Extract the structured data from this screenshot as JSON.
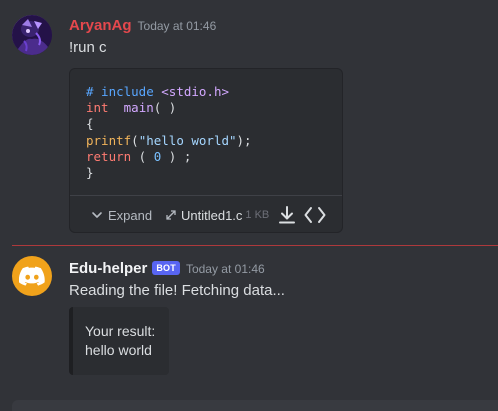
{
  "messages": [
    {
      "username": "AryanAg",
      "timestamp": "Today at 01:46",
      "text": "!run c",
      "attachment": {
        "code_lines": [
          [
            {
              "t": "# include ",
              "c": "kw-blue"
            },
            {
              "t": "<stdio.h>",
              "c": "kw-purple"
            }
          ],
          [
            {
              "t": "int ",
              "c": "kw-red"
            },
            {
              "t": " ",
              "c": ""
            },
            {
              "t": "main",
              "c": "kw-purple"
            },
            {
              "t": "( )",
              "c": ""
            }
          ],
          [
            {
              "t": "{",
              "c": ""
            }
          ],
          [
            {
              "t": "printf",
              "c": "kw-yellow"
            },
            {
              "t": "(",
              "c": ""
            },
            {
              "t": "\"hello world\"",
              "c": "str-blue"
            },
            {
              "t": ");",
              "c": ""
            }
          ],
          [
            {
              "t": "return",
              "c": "kw-red"
            },
            {
              "t": " ( ",
              "c": ""
            },
            {
              "t": "0",
              "c": "num-cyan"
            },
            {
              "t": " ) ;",
              "c": ""
            }
          ],
          [
            {
              "t": "}",
              "c": ""
            }
          ]
        ],
        "expand_label": "Expand",
        "filename": "Untitled1.c",
        "filesize": "1 KB"
      }
    },
    {
      "username": "Edu-helper",
      "bot_tag": "BOT",
      "timestamp": "Today at 01:46",
      "text": "Reading the file! Fetching data...",
      "embed": {
        "line1": "Your result:",
        "line2": "hello world"
      }
    }
  ],
  "colors": {
    "background": "#313338",
    "user_name": "#e5484d",
    "bot_avatar": "#f0a21b",
    "bot_tag": "#5865f2",
    "new_divider": "#d83c3e"
  },
  "icons": {
    "expand": "chevron-down-icon",
    "open_file": "expand-arrows-icon",
    "download": "download-icon",
    "view_code": "code-brackets-icon",
    "bot_avatar": "discord-logo-icon"
  }
}
